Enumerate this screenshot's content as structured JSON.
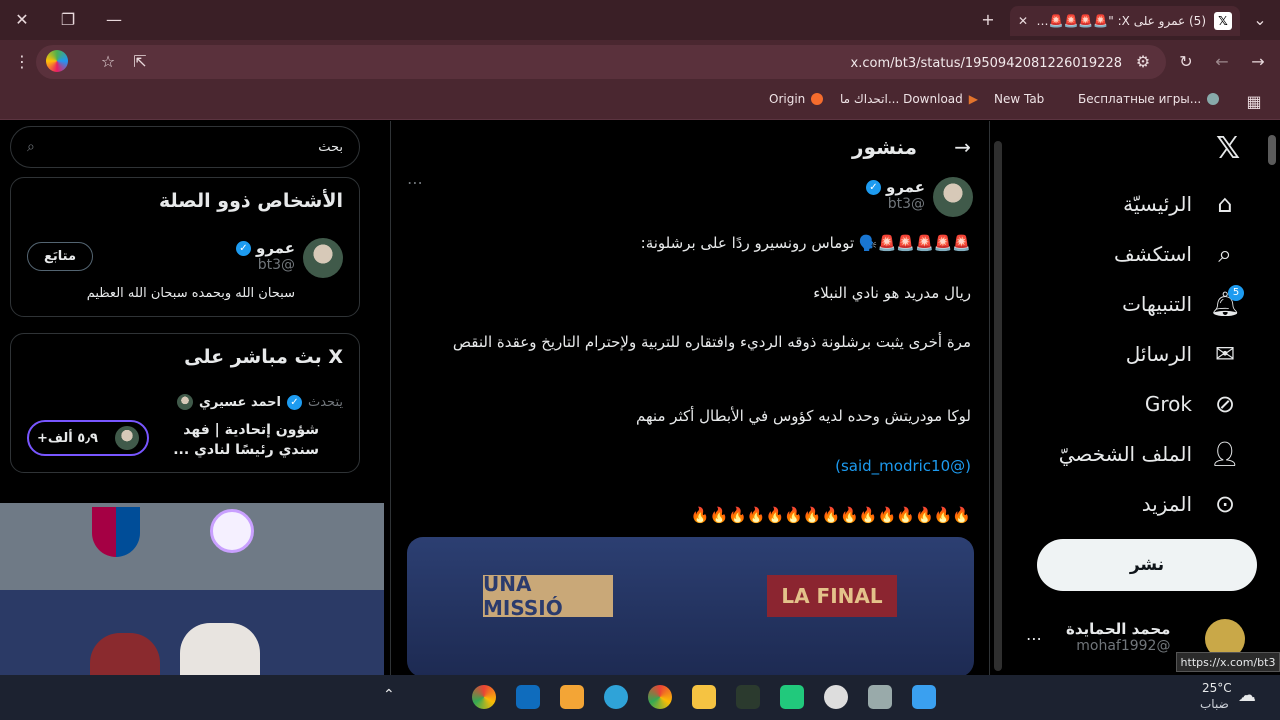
{
  "browser": {
    "tab_title": "(5) عمرو على X: \"🚨🚨🚨🚨🚨 ",
    "url": "x.com/bt3/status/1950942081226019228",
    "bookmarks": [
      "Бесплатные игры...",
      "New Tab",
      "اتحداك ما... Download",
      "Origin"
    ]
  },
  "search": {
    "placeholder": "بحث"
  },
  "related": {
    "title": "الأشخاص ذوو الصلة",
    "name": "عمرو",
    "handle": "@bt3",
    "bio": "سبحان الله وبحمده سبحان الله العظيم",
    "follow_label": "متابَع"
  },
  "live": {
    "title": "X بث مباشر على",
    "host": "احمد عسيري",
    "speaking": "يتحدث",
    "topic": "شؤون إتحادية | فهد سندي رئيسًا لنادي ...",
    "listeners": "+٥٫٩ ألف"
  },
  "post": {
    "header": "منشور",
    "author": "عمرو",
    "handle": "@bt3",
    "line1": "🚨🚨🚨🚨🚨🗣️ توماس رونسيرو ردًا على برشلونة:",
    "line2": "ريال مدريد هو نادي النبلاء",
    "line3": "مرة أخرى يثبت برشلونة ذوقه الرديء وافتقاره للتربية ولإحترام التاريخ وعقدة النقص",
    "line4": "لوكا مودريتش وحده لديه كؤوس في الأبطال أكثر منهم",
    "mention": "(@said_modric10)",
    "fire": "🔥🔥🔥🔥🔥🔥🔥🔥🔥🔥🔥🔥🔥🔥🔥",
    "banner_left": "UNA MISSIÓ",
    "banner_right": "LA FINAL"
  },
  "nav": {
    "home": "الرئيسيّة",
    "explore": "استكشف",
    "notifications": "التنبيهات",
    "notif_count": "5",
    "messages": "الرسائل",
    "grok": "Grok",
    "profile": "الملف الشخصيّ",
    "more": "المزيد",
    "post_button": "نشر"
  },
  "account": {
    "name": "محمد الحمايدة",
    "handle": "@mohaf1992"
  },
  "status_link": "https://x.com/bt3",
  "taskbar": {
    "temp": "25°C",
    "weather": "ضباب"
  },
  "colors": {
    "accent": "#1d9bf0",
    "chrome": "#4a2730"
  }
}
